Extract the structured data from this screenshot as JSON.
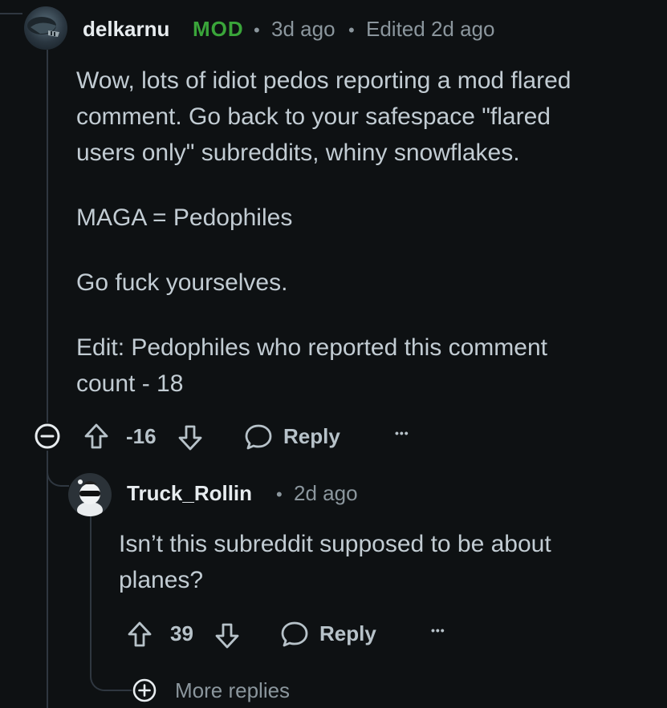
{
  "comment": {
    "username": "delkarnu",
    "badge": "MOD",
    "separator": "•",
    "posted": "3d ago",
    "edited": "Edited 2d ago",
    "paragraphs": [
      [
        "Wow, lots of idiot pedos reporting a mod flared",
        "comment. Go back to your safespace \"flared",
        "users only\" subreddits, whiny snowflakes."
      ],
      [
        "MAGA = Pedophiles"
      ],
      [
        "Go fuck yourselves."
      ],
      [
        "Edit: Pedophiles who reported this comment",
        "count - 18"
      ]
    ],
    "vote_score": "-16",
    "reply_label": "Reply",
    "overflow_label": "•••"
  },
  "reply": {
    "username": "Truck_Rollin",
    "separator": "•",
    "posted": "2d ago",
    "lines": [
      "Isn’t this subreddit supposed to be about",
      "planes?"
    ],
    "vote_score": "39",
    "reply_label": "Reply",
    "overflow_label": "•••"
  },
  "more_replies": {
    "label": "More replies"
  },
  "colors": {
    "background": "#0e1113",
    "mod_badge": "#3aa53a",
    "username": "#e7ecef",
    "meta": "#8b969d",
    "body": "#c2ccd3",
    "thread_line": "#2f3740"
  }
}
